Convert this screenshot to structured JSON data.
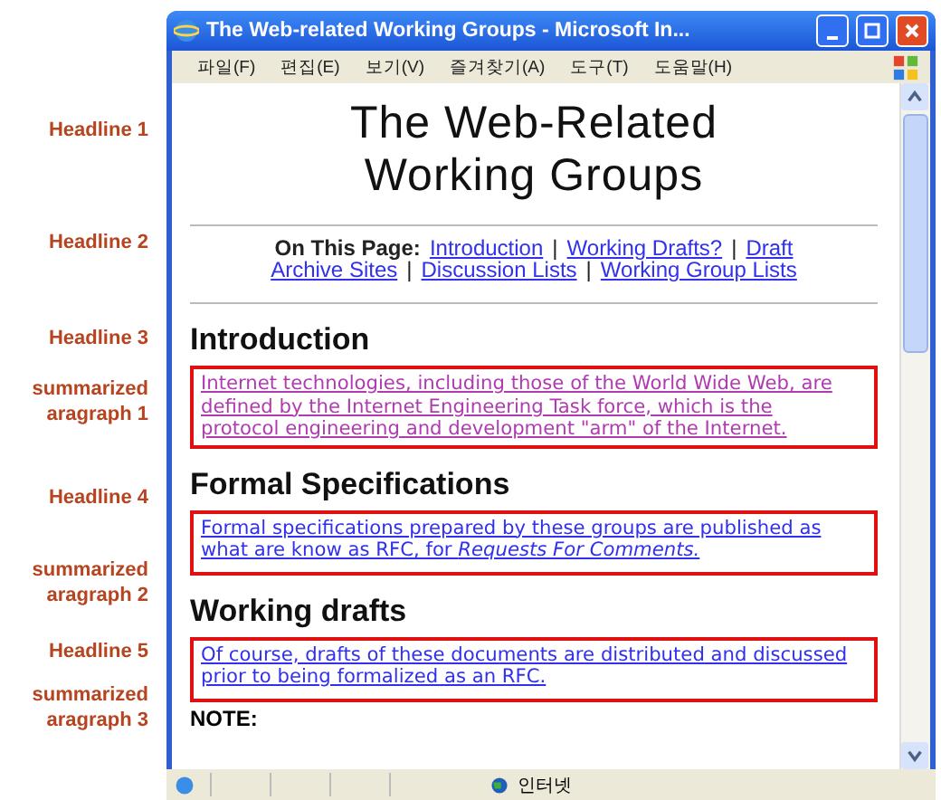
{
  "annotations": [
    {
      "lines": [
        "Headline 1"
      ]
    },
    {
      "lines": [
        "Headline 2"
      ]
    },
    {
      "lines": [
        "Headline 3"
      ]
    },
    {
      "lines": [
        "summarized",
        "aragraph 1"
      ]
    },
    {
      "lines": [
        "Headline 4"
      ]
    },
    {
      "lines": [
        "summarized",
        "aragraph 2"
      ]
    },
    {
      "lines": [
        "Headline 5"
      ]
    },
    {
      "lines": [
        "summarized",
        "aragraph 3"
      ]
    }
  ],
  "window": {
    "title": "The Web-related Working Groups - Microsoft In..."
  },
  "menu": [
    "파일(F)",
    "편집(E)",
    "보기(V)",
    "즐겨찾기(A)",
    "도구(T)",
    "도움말(H)"
  ],
  "page": {
    "title": "The Web-Related Working Groups",
    "toc": {
      "label": "On This Page:",
      "separator": "|",
      "lines": [
        [
          "Introduction",
          "Working Drafts?",
          "Draft"
        ],
        [
          "Archive Sites",
          "Discussion Lists",
          "Working Group Lists"
        ]
      ]
    },
    "sections": [
      {
        "heading": "Introduction",
        "paragraph": "Internet technologies, including those of the World Wide Web, are defined by the Internet Engineering Task force, which is the protocol engineering and development \"arm\" of the Internet.",
        "visited": true,
        "highlighted": true
      },
      {
        "heading": "Formal Specifications",
        "paragraph": "Formal specifications prepared by these groups are published as what are know as RFC, for *Requests For Comments.*",
        "visited": false,
        "highlighted": true
      },
      {
        "heading": "Working drafts",
        "paragraph": "Of course, drafts of these documents are distributed and discussed prior to being formalized as an RFC.",
        "visited": false,
        "highlighted": true
      }
    ],
    "note": "NOTE:"
  },
  "status_bar": {
    "zone": "인터넷"
  }
}
